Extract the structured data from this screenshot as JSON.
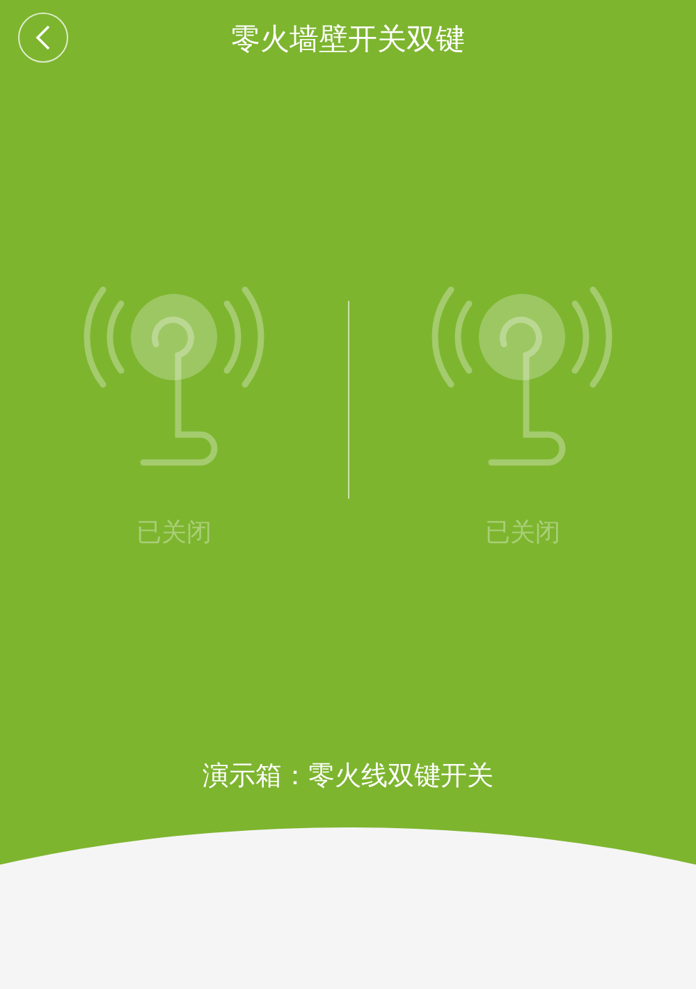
{
  "header": {
    "title": "零火墙壁开关双键"
  },
  "switches": [
    {
      "status": "已关闭",
      "on": false
    },
    {
      "status": "已关闭",
      "on": false
    }
  ],
  "caption": "演示箱：零火线双键开关"
}
